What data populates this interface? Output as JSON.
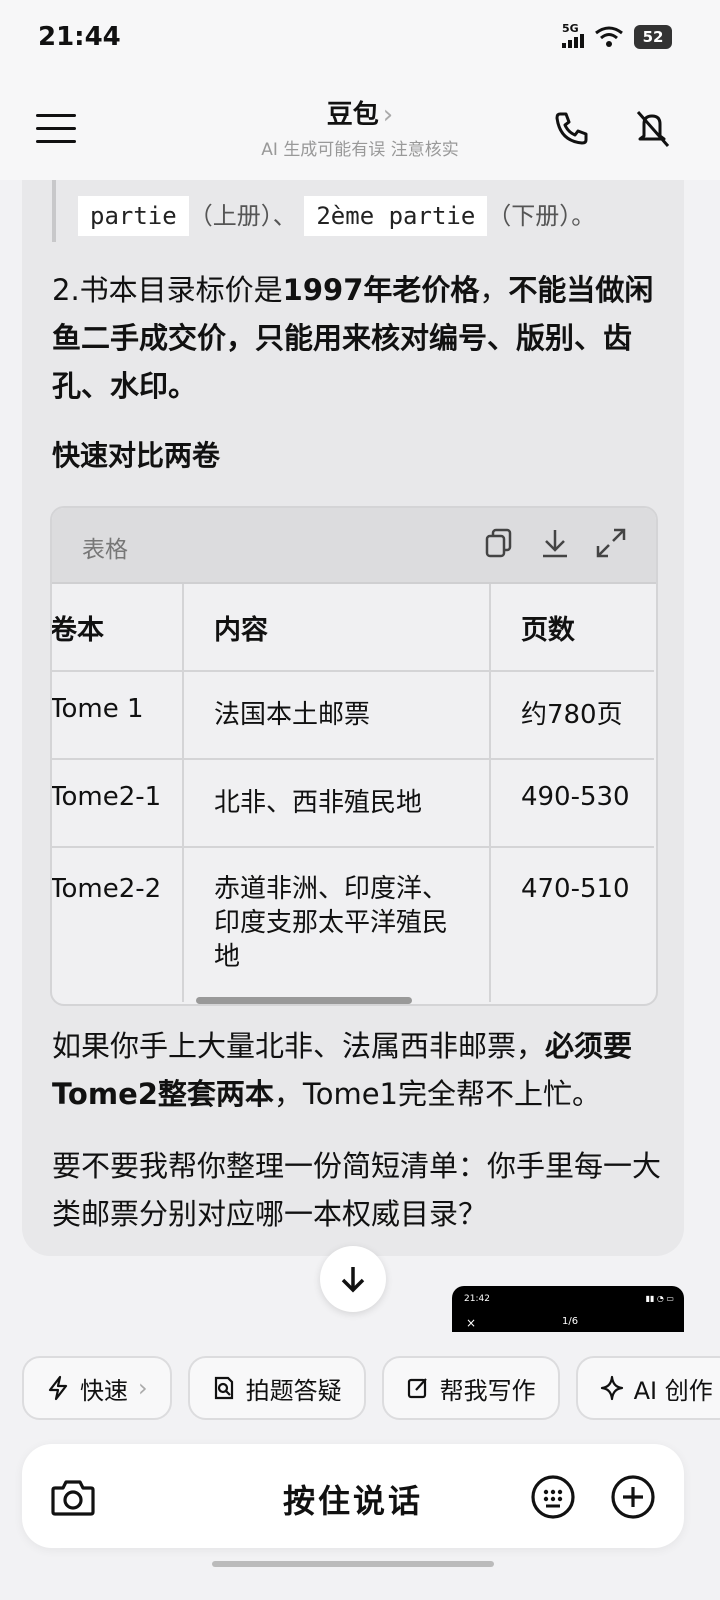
{
  "status": {
    "time": "21:44",
    "network": "5G",
    "battery": "52"
  },
  "header": {
    "title": "豆包",
    "subtitle": "AI 生成可能有误 注意核实"
  },
  "content": {
    "quote": {
      "code1": "partie",
      "text1": "（上册）、",
      "code2": "2ème partie",
      "text2": "（下册）。"
    },
    "para1": {
      "prefix": "2.书本目录标价是",
      "bold1": "1997年老价格",
      "mid": "，",
      "bold2": "不能当做闲鱼二手成交价，只能用来核对编号、版别、齿孔、水印。"
    },
    "heading": "快速对比两卷",
    "table": {
      "label": "表格",
      "headers": [
        "卷本",
        "内容",
        "页数"
      ],
      "rows": [
        [
          "Tome 1",
          "法国本土邮票",
          "约780页"
        ],
        [
          "Tome2-1",
          "北非、西非殖民地",
          "490-530"
        ],
        [
          "Tome2-2",
          "赤道非洲、印度洋、印度支那太平洋殖民地",
          "470-510"
        ]
      ]
    },
    "para2": {
      "prefix": "如果你手上大量北非、法属西非邮票，",
      "bold": "必须要Tome2整套两本",
      "suffix": "，Tome1完全帮不上忙。"
    },
    "para3": "要不要我帮你整理一份简短清单：你手里每一大类邮票分别对应哪一本权威目录？"
  },
  "mini_preview": {
    "time": "21:42",
    "close": "×",
    "page": "1/6"
  },
  "chips": [
    {
      "icon": "lightning-icon",
      "label": "快速"
    },
    {
      "icon": "photo-search-icon",
      "label": "拍题答疑"
    },
    {
      "icon": "edit-icon",
      "label": "帮我写作"
    },
    {
      "icon": "sparkle-icon",
      "label": "AI 创作"
    }
  ],
  "input": {
    "hold_to_talk": "按住说话"
  }
}
